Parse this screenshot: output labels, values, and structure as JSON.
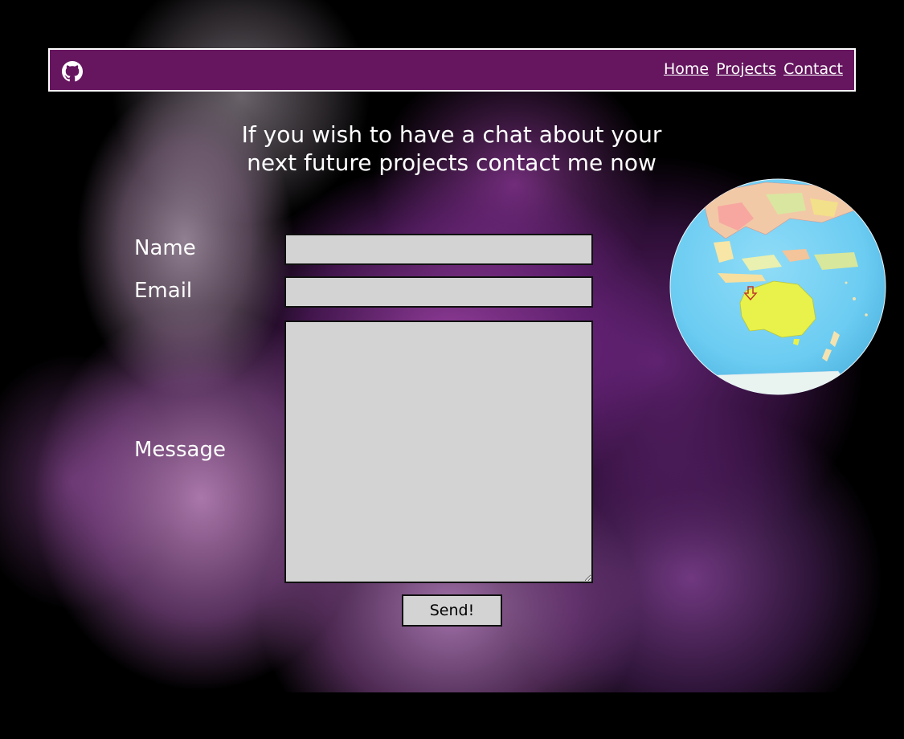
{
  "nav": {
    "links": [
      "Home",
      "Projects",
      "Contact"
    ]
  },
  "hero": {
    "line1": "If you wish to have a chat about your",
    "line2": "next future projects contact me now"
  },
  "form": {
    "name_label": "Name",
    "name_value": "",
    "email_label": "Email",
    "email_value": "",
    "message_label": "Message",
    "message_value": "",
    "send_label": "Send!"
  },
  "icons": {
    "brand": "github-icon",
    "illustration": "globe-icon"
  },
  "colors": {
    "navbar_bg": "#66165f",
    "navbar_border": "#ffffff",
    "field_bg": "#d3d3d3",
    "text": "#ffffff"
  }
}
